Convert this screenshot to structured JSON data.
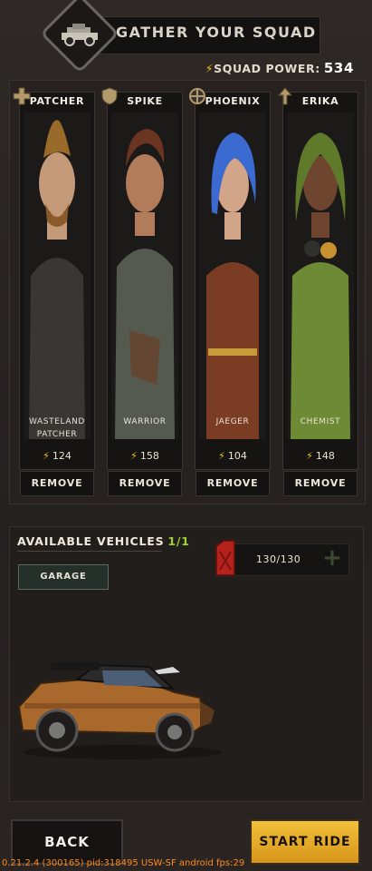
{
  "header": {
    "title": "GATHER YOUR SQUAD",
    "icon": "armored-car-icon"
  },
  "squad_power": {
    "label": "SQUAD POWER:",
    "value": "534"
  },
  "squad": [
    {
      "name": "PATCHER",
      "role": "Wasteland patcher",
      "power": "124",
      "class_icon": "medic-cross-icon",
      "remove_label": "REMOVE",
      "hair": "#9a6a2a",
      "skin": "#c59a78",
      "outfit": "#3a3633"
    },
    {
      "name": "SPIKE",
      "role": "Warrior",
      "power": "158",
      "class_icon": "shield-icon",
      "remove_label": "REMOVE",
      "hair": "#6a3420",
      "skin": "#b27b59",
      "outfit": "#555a50"
    },
    {
      "name": "PHOENIX",
      "role": "Jaeger",
      "power": "104",
      "class_icon": "crosshair-icon",
      "remove_label": "REMOVE",
      "hair": "#3b6ad0",
      "skin": "#d2a589",
      "outfit": "#7a3c22"
    },
    {
      "name": "ERIKA",
      "role": "Chemist",
      "power": "148",
      "class_icon": "arrow-up-icon",
      "remove_label": "REMOVE",
      "hair": "#5e7a2a",
      "skin": "#6e4630",
      "outfit": "#6d8a34"
    }
  ],
  "vehicles": {
    "title": "AVAILABLE VEHICLES",
    "count": "1/1",
    "garage_label": "GARAGE",
    "fuel": "130/130",
    "fuel_icon": "jerry-can-icon",
    "add_icon": "plus-icon"
  },
  "buttons": {
    "back": "BACK",
    "start": "START RIDE"
  },
  "debug": "0.21.2.4 (300165) pid:318495 USW-SF android fps:29",
  "colors": {
    "accent": "#f2c320",
    "start_button": "#e3a72a",
    "count_green": "#9fd230"
  }
}
